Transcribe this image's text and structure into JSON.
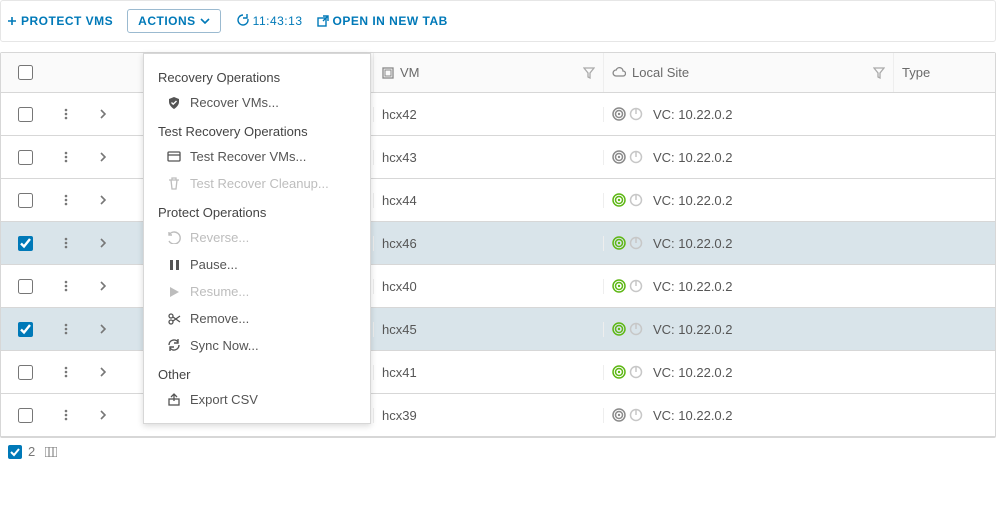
{
  "toolbar": {
    "protect_label": "PROTECT VMS",
    "actions_label": "ACTIONS",
    "time": "11:43:13",
    "open_tab_label": "OPEN IN NEW TAB"
  },
  "columns": {
    "vm": "VM",
    "local_site": "Local Site",
    "type": "Type"
  },
  "site_prefix": "VC:",
  "rows": [
    {
      "vm": "hcx42",
      "site": "10.22.0.2",
      "selected": false,
      "status": "idle"
    },
    {
      "vm": "hcx43",
      "site": "10.22.0.2",
      "selected": false,
      "status": "idle"
    },
    {
      "vm": "hcx44",
      "site": "10.22.0.2",
      "selected": false,
      "status": "ok"
    },
    {
      "vm": "hcx46",
      "site": "10.22.0.2",
      "selected": true,
      "status": "ok"
    },
    {
      "vm": "hcx40",
      "site": "10.22.0.2",
      "selected": false,
      "status": "ok"
    },
    {
      "vm": "hcx45",
      "site": "10.22.0.2",
      "selected": true,
      "status": "ok"
    },
    {
      "vm": "hcx41",
      "site": "10.22.0.2",
      "selected": false,
      "status": "ok"
    },
    {
      "vm": "hcx39",
      "site": "10.22.0.2",
      "selected": false,
      "status": "idle"
    }
  ],
  "dropdown": {
    "recovery_header": "Recovery Operations",
    "recover": "Recover VMs...",
    "test_header": "Test Recovery Operations",
    "test_recover": "Test Recover VMs...",
    "test_cleanup": "Test Recover Cleanup...",
    "protect_header": "Protect Operations",
    "reverse": "Reverse...",
    "pause": "Pause...",
    "resume": "Resume...",
    "remove": "Remove...",
    "sync": "Sync Now...",
    "other_header": "Other",
    "export": "Export CSV"
  },
  "footer": {
    "selected_count": "2"
  },
  "colors": {
    "link": "#0079b8",
    "sel_row": "#d9e4ea",
    "ok_green": "#5eb715",
    "idle_gray": "#8a8a8a",
    "highlight": "#d8232a"
  }
}
